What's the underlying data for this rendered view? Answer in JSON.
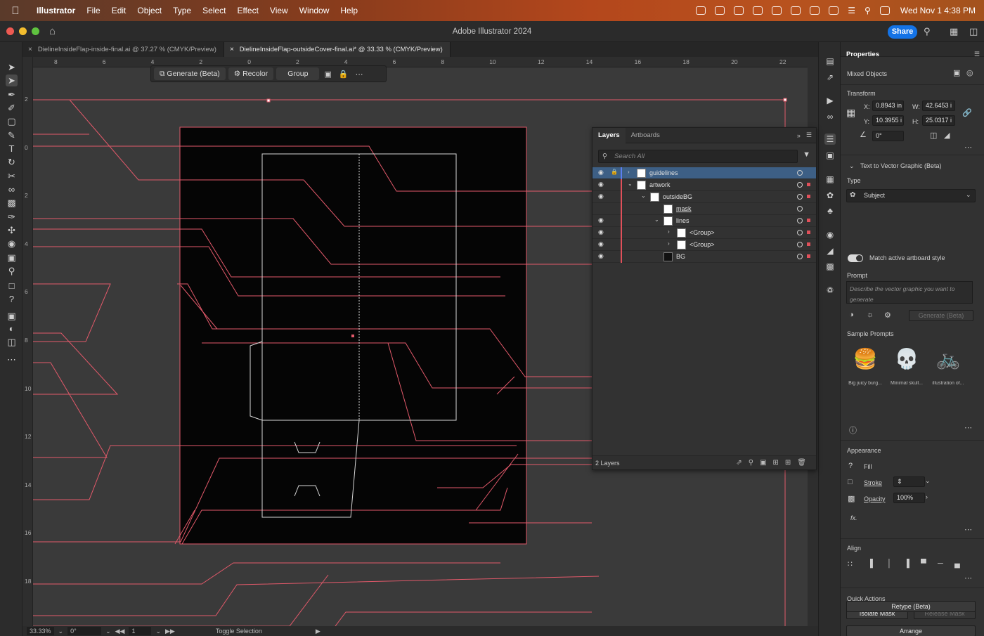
{
  "menubar": {
    "app": "Illustrator",
    "items": [
      "File",
      "Edit",
      "Object",
      "Type",
      "Select",
      "Effect",
      "View",
      "Window",
      "Help"
    ],
    "clock": "Wed Nov 1  4:38 PM"
  },
  "window": {
    "title": "Adobe Illustrator 2024",
    "share_label": "Share"
  },
  "tabs": [
    {
      "label": "DielineInsideFlap-inside-final.ai @ 37.27 % (CMYK/Preview)",
      "active": false
    },
    {
      "label": "DielineInsideFlap-outsideCover-final.ai* @ 33.33 % (CMYK/Preview)",
      "active": true
    }
  ],
  "ruler": {
    "top": [
      "8",
      "6",
      "4",
      "2",
      "0",
      "2",
      "4",
      "6",
      "8",
      "10",
      "12",
      "14",
      "16",
      "18",
      "20",
      "22"
    ],
    "left": [
      "2",
      "0",
      "2",
      "4",
      "6",
      "8",
      "10",
      "12",
      "14",
      "16",
      "18"
    ]
  },
  "taskbar": {
    "generate": "Generate (Beta)",
    "recolor": "Recolor",
    "group": "Group"
  },
  "layers_panel": {
    "tabs": [
      "Layers",
      "Artboards"
    ],
    "search_placeholder": "Search All",
    "rows": [
      {
        "name": "guidelines",
        "indent": 0,
        "caret": "right",
        "selected": true
      },
      {
        "name": "artwork",
        "indent": 0,
        "caret": "down"
      },
      {
        "name": "outsideBG",
        "indent": 1,
        "caret": "down"
      },
      {
        "name": "mask",
        "indent": 2,
        "caret": ""
      },
      {
        "name": "lines",
        "indent": 2,
        "caret": "down"
      },
      {
        "name": "<Group>",
        "indent": 3,
        "caret": "right"
      },
      {
        "name": "<Group>",
        "indent": 3,
        "caret": "right"
      },
      {
        "name": "BG",
        "indent": 2,
        "caret": ""
      }
    ],
    "footer": "2 Layers"
  },
  "properties": {
    "title": "Properties",
    "selection": "Mixed Objects",
    "transform": {
      "label": "Transform",
      "x": "0.8943 in",
      "y": "10.3955 i",
      "w": "42.6453 i",
      "h": "25.0317 i",
      "angle": "0°"
    },
    "text_to_vector": {
      "label": "Text to Vector Graphic (Beta)",
      "type_label": "Type",
      "type_value": "Subject",
      "match_label": "Match active artboard style",
      "prompt_label": "Prompt",
      "prompt_placeholder": "Describe the vector graphic you want to generate",
      "generate": "Generate (Beta)",
      "samples_label": "Sample Prompts",
      "samples": [
        "Big juicy burg...",
        "Minimal skull...",
        "illustration of..."
      ]
    },
    "appearance": {
      "label": "Appearance",
      "fill": "Fill",
      "stroke": "Stroke",
      "opacity": "Opacity",
      "opacity_value": "100%",
      "fx": "fx."
    },
    "align": {
      "label": "Align"
    },
    "quick_actions": {
      "label": "Quick Actions",
      "isolate": "Isolate Mask",
      "release": "Release Mask",
      "arrange": "Arrange",
      "retype": "Retype (Beta)"
    }
  },
  "statusbar": {
    "zoom": "33.33%",
    "rotate": "0°",
    "artboard": "1",
    "mode": "Toggle Selection"
  },
  "colors": {
    "guide": "#e2596a",
    "accent": "#1473e6",
    "artboard": "#050505"
  }
}
